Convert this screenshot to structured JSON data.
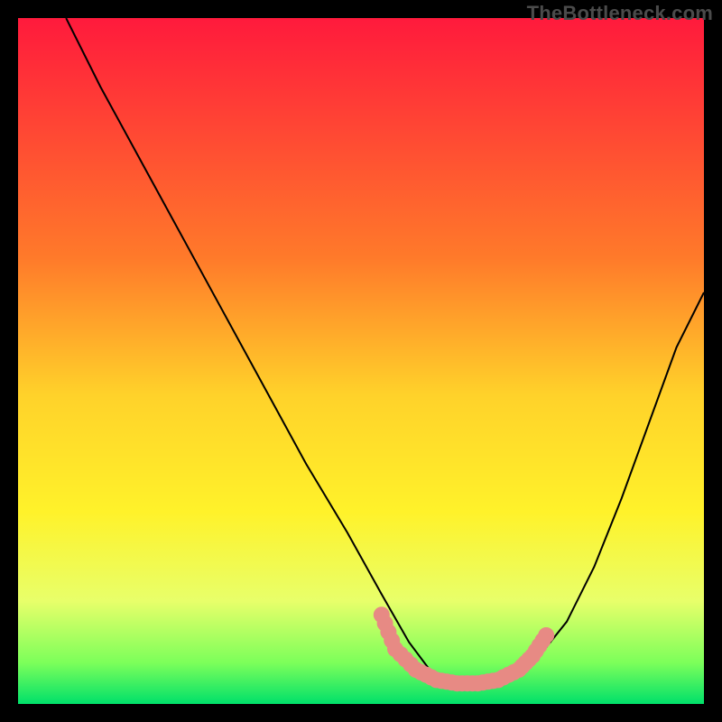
{
  "watermark": {
    "text": "TheBottleneck.com"
  },
  "chart_data": {
    "type": "line",
    "title": "",
    "xlabel": "",
    "ylabel": "",
    "xlim": [
      0,
      100
    ],
    "ylim": [
      0,
      100
    ],
    "grid": false,
    "gradient_stops": [
      {
        "offset": 0,
        "color": "#ff1a3c"
      },
      {
        "offset": 35,
        "color": "#ff7a2a"
      },
      {
        "offset": 55,
        "color": "#ffd22a"
      },
      {
        "offset": 72,
        "color": "#fff22a"
      },
      {
        "offset": 85,
        "color": "#e8ff6a"
      },
      {
        "offset": 94,
        "color": "#7cff5a"
      },
      {
        "offset": 100,
        "color": "#00e06a"
      }
    ],
    "series": [
      {
        "name": "bottleneck-curve",
        "stroke": "#000000",
        "x": [
          7,
          12,
          18,
          24,
          30,
          36,
          42,
          48,
          53,
          57,
          60,
          64,
          68,
          72,
          76,
          80,
          84,
          88,
          92,
          96,
          100
        ],
        "y": [
          100,
          90,
          79,
          68,
          57,
          46,
          35,
          25,
          16,
          9,
          5,
          3,
          3,
          4,
          7,
          12,
          20,
          30,
          41,
          52,
          60
        ]
      },
      {
        "name": "highlight-band",
        "stroke": "#e78a84",
        "thick": true,
        "x": [
          53,
          55,
          58,
          61,
          64,
          67,
          70,
          73,
          75,
          77
        ],
        "y": [
          13,
          8,
          5,
          3.5,
          3,
          3,
          3.5,
          5,
          7,
          10
        ]
      }
    ]
  }
}
